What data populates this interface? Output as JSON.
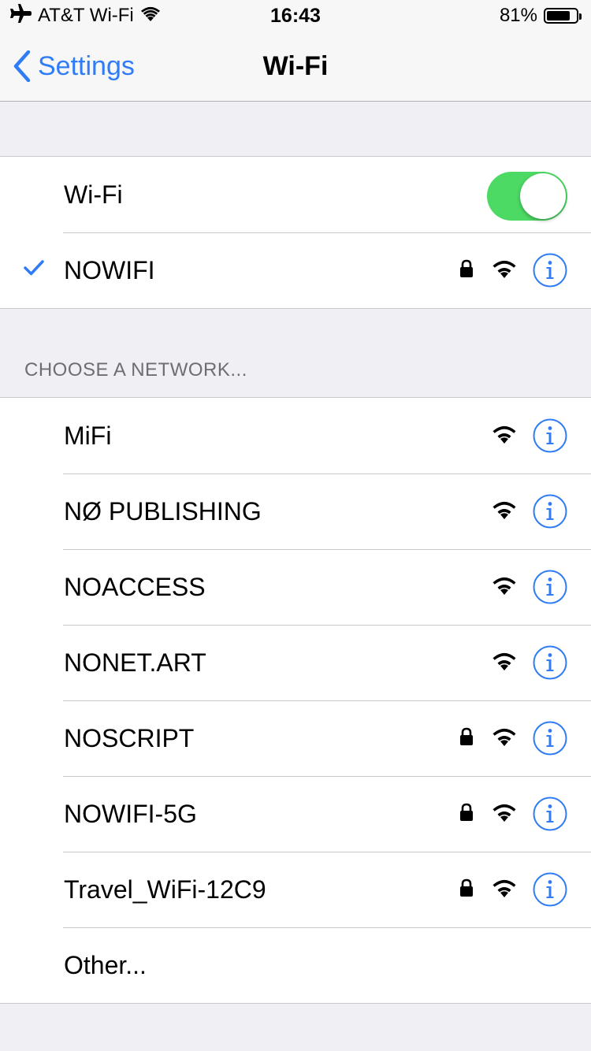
{
  "status_bar": {
    "carrier": "AT&T Wi-Fi",
    "time": "16:43",
    "battery_percent": "81%",
    "battery_level": 0.81
  },
  "nav": {
    "back_label": "Settings",
    "title": "Wi-Fi"
  },
  "wifi_toggle": {
    "label": "Wi-Fi",
    "on": true
  },
  "connected_network": {
    "name": "NOWIFI",
    "secured": true
  },
  "section_header": "CHOOSE A NETWORK...",
  "networks": [
    {
      "name": "MiFi",
      "secured": false
    },
    {
      "name": "NØ PUBLISHING",
      "secured": false
    },
    {
      "name": "NOACCESS",
      "secured": false
    },
    {
      "name": "NONET.ART",
      "secured": false
    },
    {
      "name": "NOSCRIPT",
      "secured": true
    },
    {
      "name": "NOWIFI-5G",
      "secured": true
    },
    {
      "name": "Travel_WiFi-12C9",
      "secured": true
    }
  ],
  "other_label": "Other...",
  "colors": {
    "accent": "#2f7cf6",
    "toggle_on": "#4cd964",
    "background": "#efeff4"
  }
}
